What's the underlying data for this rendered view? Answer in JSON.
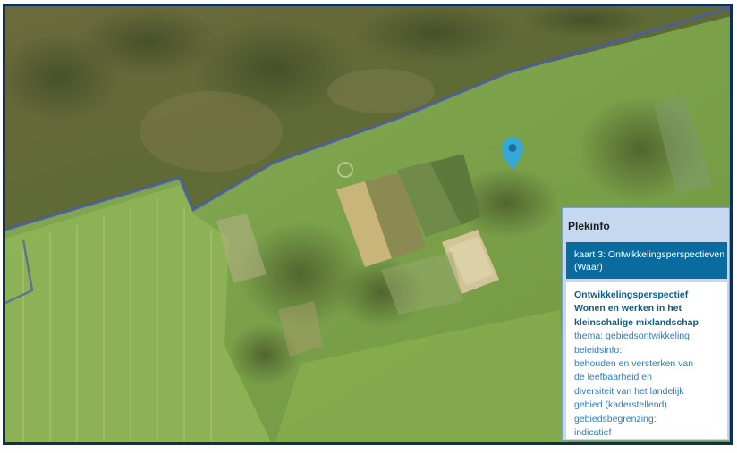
{
  "map": {
    "colors": {
      "frame": "#0d2f5e",
      "boundary_line": "#4a5aa8",
      "marker": "#35a7d8",
      "grass": "#7da24a",
      "woodland": "#5d6630"
    },
    "marker_icon": "map-pin-icon"
  },
  "plekinfo": {
    "title": "Plekinfo",
    "layer_label": "kaart 3: Ontwikkelingsperspectieven (Waar)",
    "heading_lines": [
      "Ontwikkelingsperspectief",
      "Wonen en werken in het",
      "kleinschalige mixlandschap"
    ],
    "detail_lines": [
      "thema: gebiedsontwikkeling",
      "beleidsinfo:",
      "behouden en versterken van",
      "de leefbaarheid en",
      "diversiteit van het landelijk",
      "gebied (kaderstellend)",
      "gebiedsbegrenzing:",
      "indicatief"
    ]
  }
}
